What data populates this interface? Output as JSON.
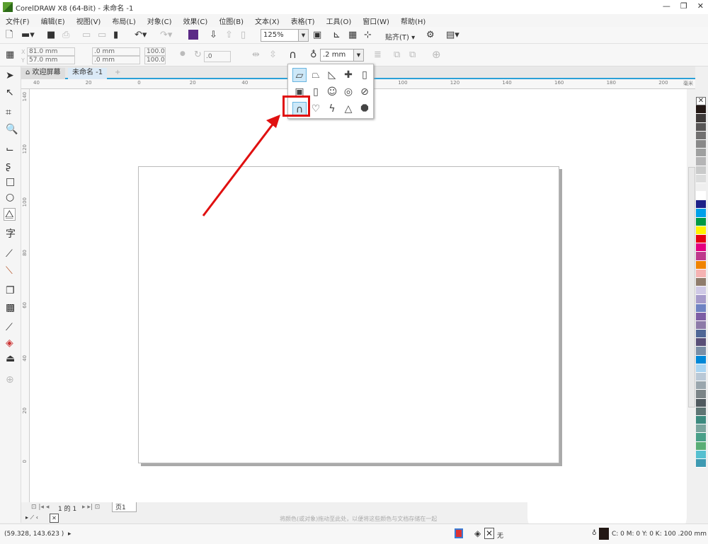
{
  "title": "CorelDRAW X8 (64-Bit) - 未命名 -1",
  "menu": [
    "文件(F)",
    "编辑(E)",
    "视图(V)",
    "布局(L)",
    "对象(C)",
    "效果(C)",
    "位图(B)",
    "文本(X)",
    "表格(T)",
    "工具(O)",
    "窗口(W)",
    "帮助(H)"
  ],
  "toolbar": {
    "zoom": "125%",
    "snap": "贴齐(T)"
  },
  "props": {
    "x": "81.0 mm",
    "y": "57.0 mm",
    "w": ".0 mm",
    "h": ".0 mm",
    "sx": "100.0",
    "sy": "100.0",
    "angle": ".0",
    "outline": ".2 mm"
  },
  "tabs": {
    "welcome": "欢迎屏幕",
    "doc": "未命名 -1"
  },
  "ruler": {
    "h": [
      "40",
      "20",
      "0",
      "20",
      "40",
      "60",
      "80",
      "100",
      "120",
      "140",
      "160",
      "180",
      "200"
    ],
    "h_unit": "毫米",
    "v": [
      "140",
      "120",
      "100",
      "80",
      "60",
      "40",
      "20",
      "0"
    ]
  },
  "popup": {
    "icons": [
      "parallelogram",
      "trapezoid",
      "right-triangle",
      "cross",
      "cylinder",
      "frame",
      "folded-corner",
      "smiley",
      "donut",
      "no-symbol",
      "arch",
      "heart",
      "lightning",
      "teardrop",
      "octagon"
    ],
    "selected": "arch",
    "highlight_color": "#e01010"
  },
  "pagenav": {
    "of": "1 的 1",
    "page": "页1"
  },
  "colorbar": {
    "hint": "将颜色(或对象)拖动至此处，以便将这些颜色与文档存储在一起"
  },
  "status": {
    "coords": "(59.328, 143.623 )",
    "fill": "无",
    "outline_info": "C: 0 M: 0 Y: 0 K: 100  .200 mm"
  },
  "palette": [
    "#231815",
    "#3e3a39",
    "#595757",
    "#727171",
    "#898989",
    "#9fa0a0",
    "#b5b5b6",
    "#c9caca",
    "#dcdddd",
    "#efefef",
    "#ffffff",
    "#1d2088",
    "#00a0e9",
    "#009944",
    "#fff100",
    "#e60012",
    "#e4007f",
    "#be3a8c",
    "#f08300",
    "#f5b2b2",
    "#8f7c6c",
    "#cfc9e6",
    "#a59aca",
    "#6f83c3",
    "#7d5ea5",
    "#8d7aa8",
    "#4f6796",
    "#594f77",
    "#7a8fa6",
    "#0088d7",
    "#a8d4f2",
    "#b9c8d6",
    "#9aa6ad",
    "#7b8487",
    "#505a5f",
    "#5e7574",
    "#3c8a7f",
    "#7aa59e",
    "#4aa089",
    "#5aae76",
    "#56c0d0",
    "#3e9ab2"
  ]
}
